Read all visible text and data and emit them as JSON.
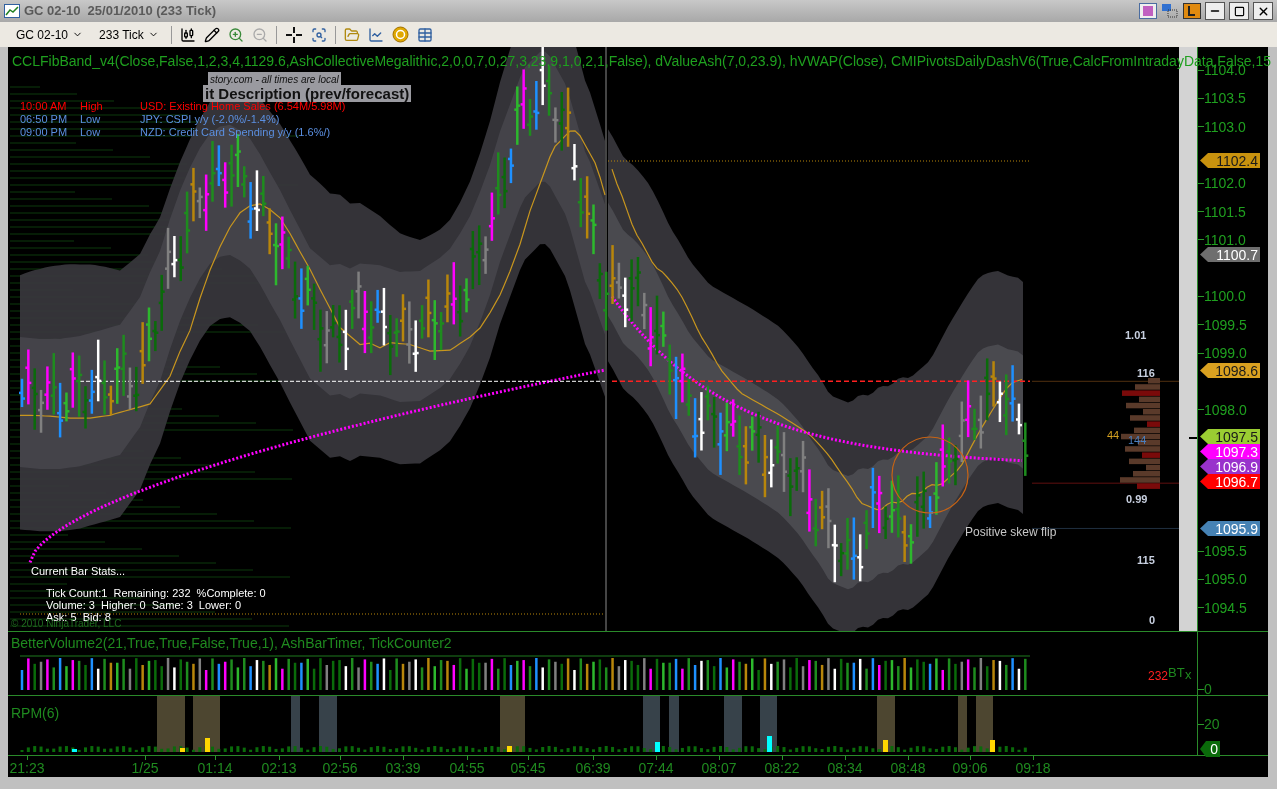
{
  "window": {
    "title": "GC 02-10  25/01/2010 (233 Tick)"
  },
  "toolbar": {
    "instrument": "GC 02-10",
    "interval": "233 Tick"
  },
  "price_panel": {
    "indicator_label": "CCLFibBand_v4(Close,False,1,2,3,4,1129.6,AshCollectiveMegalithic,2,0,0,7,0,27,3,23.9,1,0,2,1,False), dValueAsh(7,0,23.9), hVWAP(Close), CMIPivotsDailyDashV6(True,CalcFromIntradayData,False,15",
    "news_source": "story.com - all times are local",
    "news_header": "it Description (prev/forecast)",
    "news": [
      {
        "time": "10:00 AM",
        "impact": "High",
        "event": "USD: Existing Home Sales (6.54M/5.98M)",
        "color": "#ff0000"
      },
      {
        "time": "06:50 PM",
        "impact": "Low",
        "event": "JPY: CSPI y/y (-2.0%/-1.4%)",
        "color": "#5b8fe0"
      },
      {
        "time": "09:00 PM",
        "impact": "Low",
        "event": "NZD: Credit Card Spending y/y (1.6%/)",
        "color": "#5b8fe0"
      }
    ],
    "bar_stats": {
      "title": "Current Bar Stats...",
      "lines": [
        "Tick Count:1  Remaining: 232  %Complete: 0",
        "Volume: 3  Higher: 0  Same: 3  Lower: 0",
        "Ask: 5  Bid: 8"
      ]
    },
    "copyright": "© 2010 NinjaTrader, LLC",
    "annotation": "Positive skew flip",
    "profile_labels": [
      {
        "text": "1.01",
        "color": "#c8d0e0"
      },
      {
        "text": "116",
        "color": "#c8d0e0"
      },
      {
        "text": "44",
        "color": "#d4a020"
      },
      {
        "text": "144",
        "color": "#4a7fc0"
      },
      {
        "text": "0.99",
        "color": "#c8d0e0"
      },
      {
        "text": "115",
        "color": "#c8d0e0"
      },
      {
        "text": "0",
        "color": "#c8d0e0"
      }
    ],
    "price_axis": [
      "1104.0",
      "1103.5",
      "1103.0",
      "1102.0",
      "1101.5",
      "1101.0",
      "1100.0",
      "1099.5",
      "1099.0",
      "1098.0",
      "1095.5",
      "1095.0",
      "1094.5"
    ],
    "price_tags": [
      {
        "text": "1102.4",
        "color": "#c8920e"
      },
      {
        "text": "1100.7",
        "color": "#6e6e6e"
      },
      {
        "text": "1098.6",
        "color": "#d9a020"
      },
      {
        "text": "1097.5",
        "color": "#9acd32"
      },
      {
        "text": "1097.3",
        "color": "#ff00ff"
      },
      {
        "text": "1096.9",
        "color": "#9932cc"
      },
      {
        "text": "1096.7",
        "color": "#ff0000"
      },
      {
        "text": "1095.9",
        "color": "#4682b4"
      }
    ]
  },
  "volume_panel": {
    "label": "BetterVolume2(21,True,True,False,True,1), AshBarTimer, TickCounter2",
    "counter": "232",
    "timer": "BT",
    "timer_mark": "x",
    "axis_label": "0"
  },
  "rpm_panel": {
    "label": "RPM(6)",
    "axis_label": "20",
    "value_tag": "0"
  },
  "time_axis": [
    "21:23",
    "1/25",
    "01:14",
    "02:13",
    "02:56",
    "03:39",
    "04:55",
    "05:45",
    "06:39",
    "07:44",
    "08:07",
    "08:22",
    "08:34",
    "08:48",
    "09:06",
    "09:18"
  ]
}
